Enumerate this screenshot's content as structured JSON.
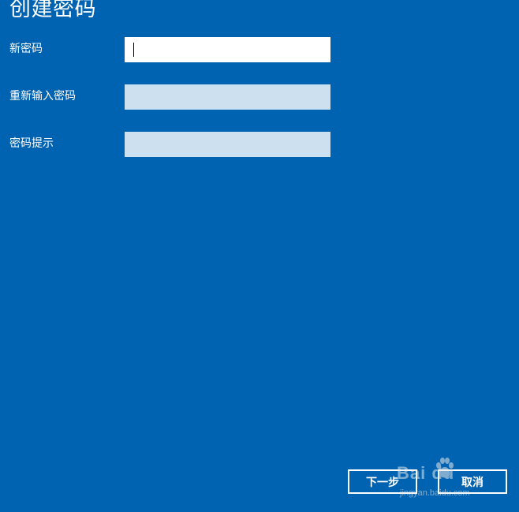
{
  "page": {
    "title": "创建密码"
  },
  "fields": [
    {
      "label": "新密码",
      "value": ""
    },
    {
      "label": "重新输入密码",
      "value": ""
    },
    {
      "label": "密码提示",
      "value": ""
    }
  ],
  "buttons": {
    "next_label": "下一步",
    "cancel_label": "取消"
  },
  "watermark": {
    "logo_text": "Bai du",
    "site_text": "jingyan.baidu.com"
  },
  "colors": {
    "background": "#0063b1",
    "active_input": "#ffffff",
    "inactive_input": "#cde0ef"
  }
}
